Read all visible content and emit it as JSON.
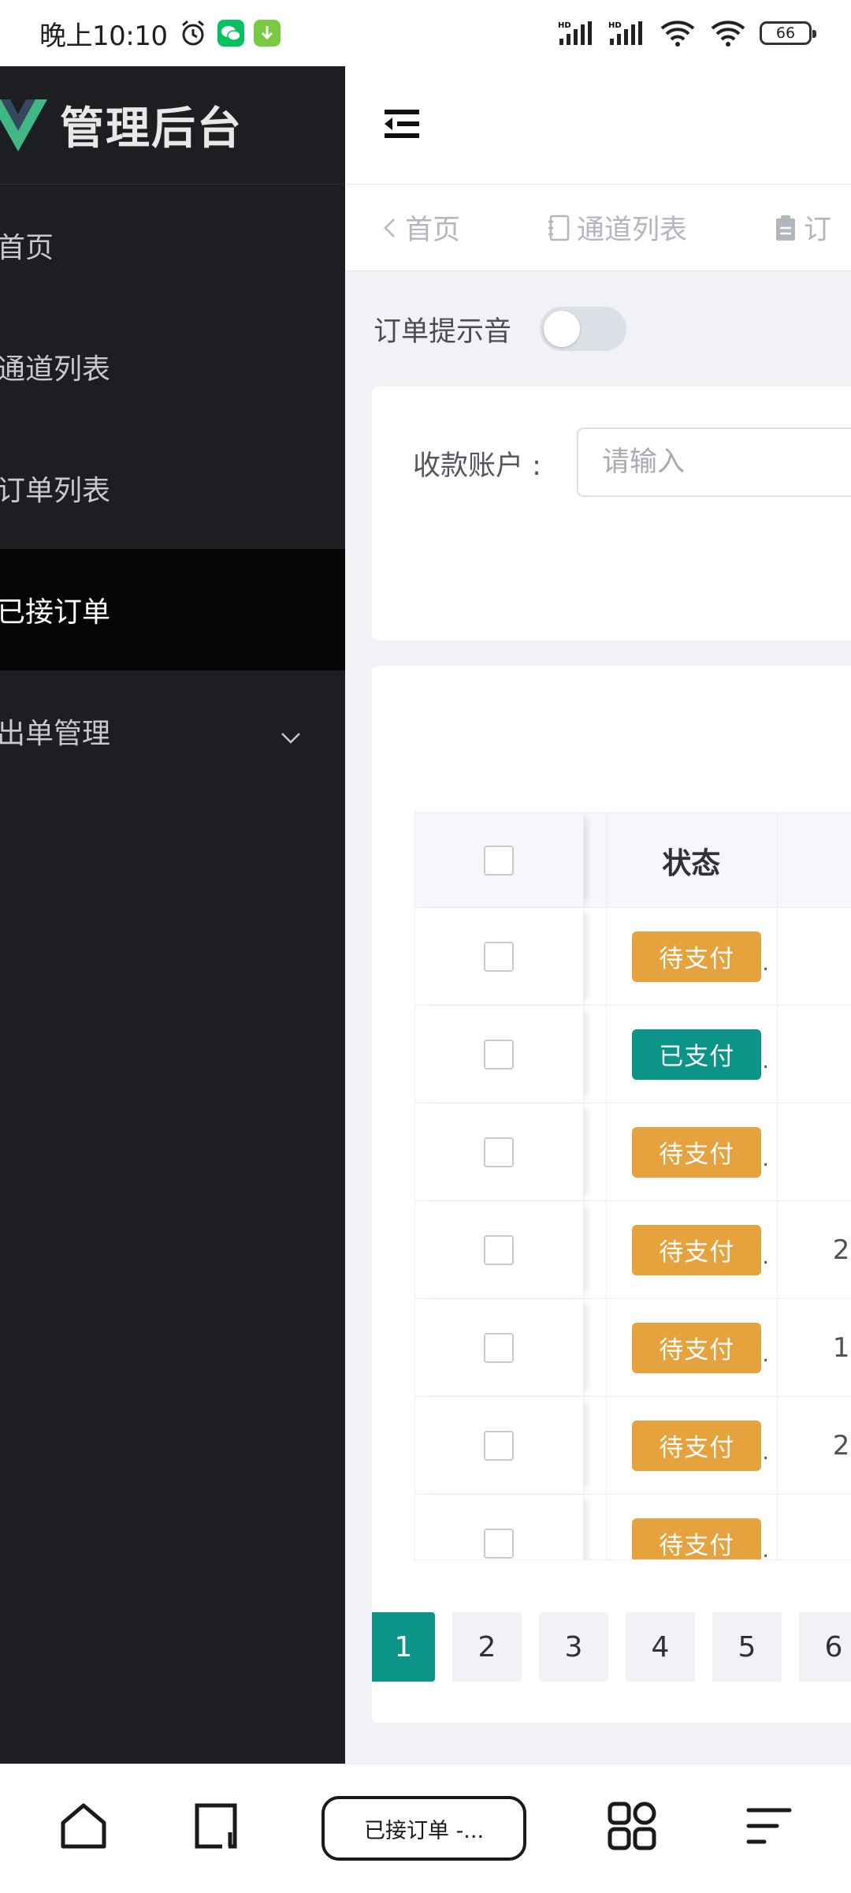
{
  "status_bar": {
    "time": "晚上10:10",
    "battery": "66",
    "network": "HD"
  },
  "sidebar": {
    "title": "管理后台",
    "items": [
      {
        "label": "首页"
      },
      {
        "label": "通道列表"
      },
      {
        "label": "订单列表"
      },
      {
        "label": "已接订单",
        "active": true
      },
      {
        "label": "出单管理",
        "expandable": true
      }
    ]
  },
  "tabs": [
    {
      "label": "首页"
    },
    {
      "label": "通道列表"
    },
    {
      "label": "订"
    }
  ],
  "filters": {
    "sound_label": "订单提示音",
    "sound_on": false,
    "account_label": "收款账户 :",
    "account_placeholder": "请输入"
  },
  "table": {
    "status_header": "状态",
    "rows": [
      {
        "status": "待支付",
        "status_color": "#e6a23c",
        "next_col": ""
      },
      {
        "status": "已支付",
        "status_color": "#0d9488",
        "next_col": ""
      },
      {
        "status": "待支付",
        "status_color": "#e6a23c",
        "next_col": ""
      },
      {
        "status": "待支付",
        "status_color": "#e6a23c",
        "next_col": "2"
      },
      {
        "status": "待支付",
        "status_color": "#e6a23c",
        "next_col": "1"
      },
      {
        "status": "待支付",
        "status_color": "#e6a23c",
        "next_col": "2"
      },
      {
        "status": "待支付",
        "status_color": "#e6a23c",
        "next_col": ""
      }
    ]
  },
  "pagination": {
    "pages": [
      "1",
      "2",
      "3",
      "4",
      "5",
      "6"
    ],
    "current": "1"
  },
  "browser": {
    "current_tab": "已接订单 -..."
  },
  "colors": {
    "sidebar_bg": "#1d1e22",
    "active_item_bg": "#050506",
    "primary": "#0d9488",
    "warning": "#e6a23c"
  }
}
